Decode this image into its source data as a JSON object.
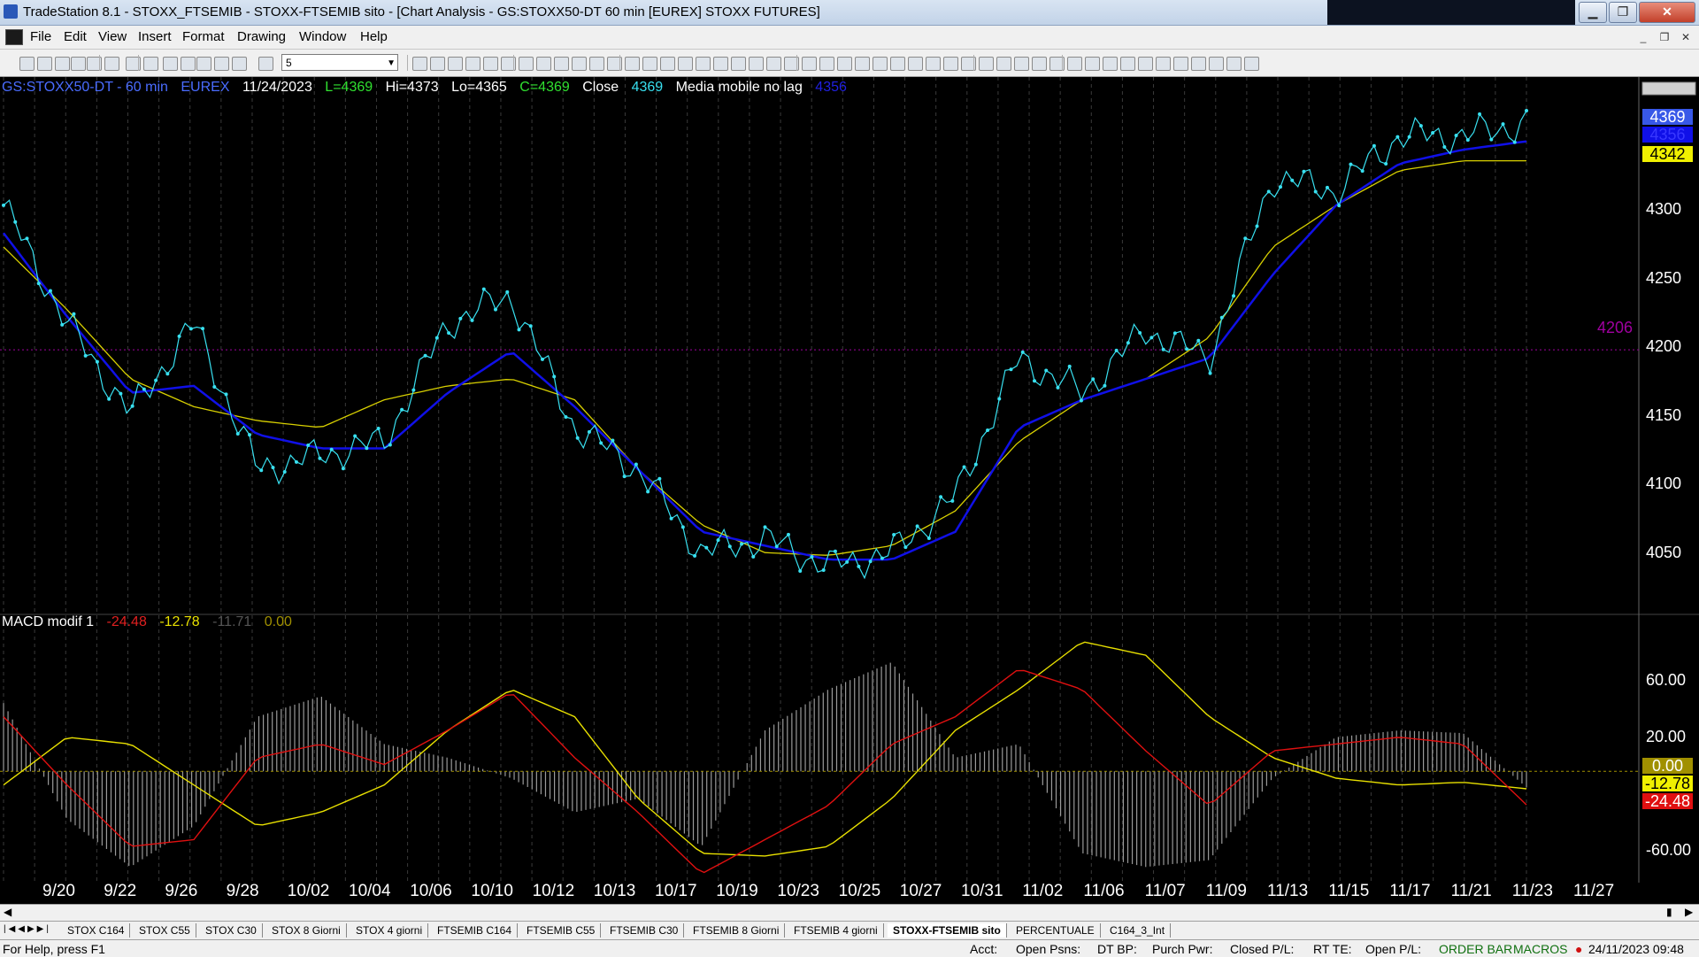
{
  "window": {
    "title": "TradeStation 8.1 - STOXX_FTSEMIB - STOXX-FTSEMIB sito - [Chart Analysis - GS:STOXX50-DT  60 min  [EUREX] STOXX FUTURES]"
  },
  "menu": [
    "File",
    "Edit",
    "View",
    "Insert",
    "Format",
    "Drawing",
    "Window",
    "Help"
  ],
  "toolbar": {
    "interval_value": "5"
  },
  "chart_header": {
    "symbol": "GS:STOXX50-DT - 60 min",
    "exchange": "EUREX",
    "date": "11/24/2023",
    "last": "L=4369",
    "high": "Hi=4373",
    "low": "Lo=4365",
    "close": "C=4369",
    "close_label": "Close",
    "close_value": "4369",
    "indicator_name": "Media mobile no lag",
    "indicator_value": "4356"
  },
  "macd_header": {
    "name": "MACD modif 1",
    "v1": "-24.48",
    "v2": "-12.78",
    "v3": "-11.71",
    "v4": "0.00"
  },
  "colors": {
    "price": "#38e0f0",
    "ma_blue": "#1010e8",
    "ma_yellow": "#d8d000",
    "macd_red": "#e01010",
    "macd_yellow": "#e8e000",
    "hist": "#9a9a9a",
    "level": "#a000a0"
  },
  "price_axis": {
    "labels": [
      "4300",
      "4250",
      "4200",
      "4150",
      "4100",
      "4050"
    ]
  },
  "price_tags": {
    "last": "4369",
    "blue": "4356",
    "yellow": "4342",
    "level": "4206"
  },
  "macd_axis": {
    "labels": [
      "60.00",
      "20.00",
      "0.00",
      "-60.00"
    ]
  },
  "macd_tags": {
    "zero": "0.00",
    "yellow": "-12.78",
    "red": "-24.48"
  },
  "date_axis": {
    "labels": [
      "9/20",
      "9/22",
      "9/26",
      "9/28",
      "10/02",
      "10/04",
      "10/06",
      "10/10",
      "10/12",
      "10/13",
      "10/17",
      "10/19",
      "10/23",
      "10/25",
      "10/27",
      "10/31",
      "11/02",
      "11/06",
      "11/07",
      "11/09",
      "11/13",
      "11/15",
      "11/17",
      "11/21",
      "11/23",
      "11/27"
    ]
  },
  "chart_data": [
    {
      "type": "line",
      "x": [
        "9/20",
        "9/22",
        "9/26",
        "9/28",
        "10/02",
        "10/04",
        "10/06",
        "10/10",
        "10/12",
        "10/13",
        "10/17",
        "10/19",
        "10/23",
        "10/25",
        "10/27",
        "10/31",
        "11/02",
        "11/06",
        "11/07",
        "11/09",
        "11/13",
        "11/15",
        "11/17",
        "11/21",
        "11/23"
      ],
      "series": [
        {
          "name": "Close",
          "values": [
            4310,
            4225,
            4160,
            4225,
            4120,
            4130,
            4140,
            4225,
            4245,
            4150,
            4120,
            4060,
            4070,
            4050,
            4060,
            4100,
            4200,
            4175,
            4220,
            4200,
            4330,
            4320,
            4360,
            4360,
            4369
          ]
        },
        {
          "name": "Media mobile no lag",
          "values": [
            4290,
            4230,
            4175,
            4180,
            4145,
            4135,
            4135,
            4175,
            4205,
            4165,
            4120,
            4075,
            4065,
            4055,
            4055,
            4075,
            4150,
            4170,
            4185,
            4200,
            4260,
            4310,
            4340,
            4350,
            4356
          ]
        },
        {
          "values": [
            4280,
            4235,
            4185,
            4165,
            4155,
            4150,
            4170,
            4180,
            4185,
            4170,
            4120,
            4080,
            4060,
            4058,
            4065,
            4090,
            4140,
            4170,
            4185,
            4215,
            4280,
            4310,
            4335,
            4342,
            4342
          ]
        }
      ],
      "ylim": [
        4020,
        4380
      ],
      "hlines": [
        4206
      ]
    },
    {
      "type": "line",
      "x": [
        "9/20",
        "9/22",
        "9/26",
        "9/28",
        "10/02",
        "10/04",
        "10/06",
        "10/10",
        "10/12",
        "10/13",
        "10/17",
        "10/19",
        "10/23",
        "10/25",
        "10/27",
        "10/31",
        "11/02",
        "11/06",
        "11/07",
        "11/09",
        "11/13",
        "11/15",
        "11/17",
        "11/21",
        "11/23"
      ],
      "series": [
        {
          "name": "MACD modif 1",
          "values": [
            40,
            -10,
            -55,
            -50,
            10,
            20,
            5,
            30,
            58,
            10,
            -30,
            -75,
            -50,
            -25,
            20,
            40,
            75,
            60,
            15,
            -25,
            15,
            20,
            25,
            20,
            -24.48
          ]
        },
        {
          "values": [
            -10,
            25,
            20,
            -10,
            -40,
            -30,
            -10,
            30,
            60,
            40,
            -20,
            -60,
            -62,
            -55,
            -20,
            30,
            60,
            95,
            85,
            40,
            10,
            -5,
            -10,
            -8,
            -12.78
          ]
        },
        {
          "values": [
            50,
            -35,
            -70,
            -40,
            40,
            55,
            20,
            10,
            -5,
            -30,
            -20,
            -55,
            30,
            60,
            80,
            10,
            20,
            -60,
            -70,
            -65,
            -5,
            25,
            30,
            28,
            -11.71
          ]
        }
      ],
      "ylim": [
        -75,
        100
      ],
      "hlines": [
        0
      ]
    }
  ],
  "sheet_tabs": [
    "STOX C164",
    "STOX C55",
    "STOX  C30",
    "STOX  8 Giorni",
    "STOX 4 giorni",
    "FTSEMIB C164",
    "FTSEMIB C55",
    "FTSEMIB C30",
    "FTSEMIB  8 Giorni",
    "FTSEMIB  4 giorni",
    "STOXX-FTSEMIB sito",
    "PERCENTUALE",
    "C164_3_Int"
  ],
  "status": {
    "help": "For Help, press F1",
    "acct": "Acct:",
    "open_psns": "Open Psns:",
    "dt_bp": "DT BP:",
    "purch_pwr": "Purch Pwr:",
    "closed_pl": "Closed P/L:",
    "rt_te": "RT TE:",
    "open_pl": "Open P/L:",
    "order_bar": "ORDER BAR",
    "macros": "MACROS",
    "datetime": "24/11/2023 09:48"
  }
}
